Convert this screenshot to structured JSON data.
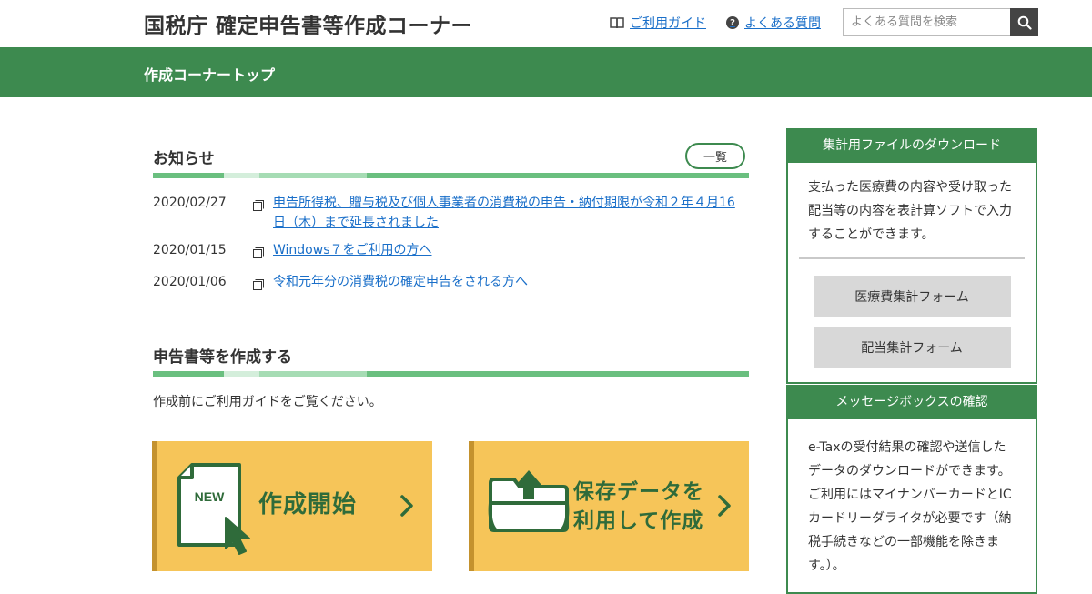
{
  "header": {
    "site_title": "国税庁 確定申告書等作成コーナー",
    "guide_label": "ご利用ガイド",
    "faq_label": "よくある質問",
    "search_placeholder": "よくある質問を検索"
  },
  "band": {
    "title": "作成コーナートップ"
  },
  "news": {
    "title": "お知らせ",
    "list_button": "一覧",
    "items": [
      {
        "date": "2020/02/27",
        "text": "申告所得税、贈与税及び個人事業者の消費税の申告・納付期限が令和２年４月16日（木）まで延長されました"
      },
      {
        "date": "2020/01/15",
        "text": "Windows７をご利用の方へ"
      },
      {
        "date": "2020/01/06",
        "text": "令和元年分の消費税の確定申告をされる方へ"
      }
    ]
  },
  "create": {
    "title": "申告書等を作成する",
    "note": "作成前にご利用ガイドをご覧ください。",
    "new_card": {
      "badge": "NEW",
      "label": "作成開始"
    },
    "saved_card": {
      "line1": "保存データを",
      "line2": "利用して作成"
    }
  },
  "sidebar": {
    "download": {
      "title": "集計用ファイルのダウンロード",
      "desc": "支払った医療費の内容や受け取った配当等の内容を表計算ソフトで入力することができます。",
      "medical_button": "医療費集計フォーム",
      "dividend_button": "配当集計フォーム"
    },
    "message": {
      "title": "メッセージボックスの確認",
      "desc": "e-Taxの受付結果の確認や送信したデータのダウンロードができます。ご利用にはマイナンバーカードとICカードリーダライタが必要です（納税手続きなどの一部機能を除きます。）。"
    }
  },
  "colors": {
    "green": "#3d8a4f",
    "card_yellow": "#f6c559",
    "link": "#1a6fc9"
  }
}
